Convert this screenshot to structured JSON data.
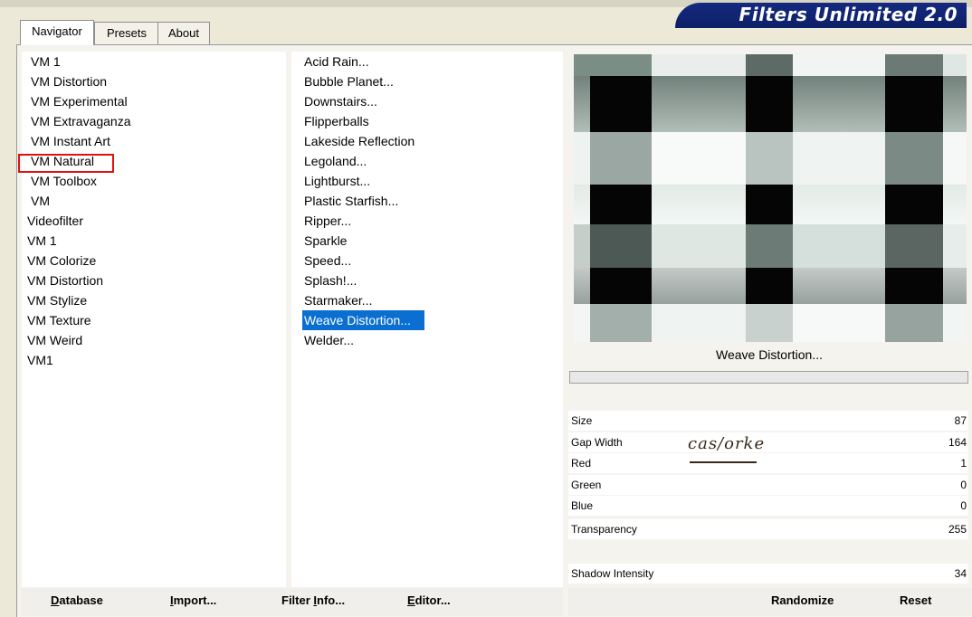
{
  "tabs": [
    "Navigator",
    "Presets",
    "About"
  ],
  "logo": "Filters Unlimited 2.0",
  "categories": [
    "VM 1",
    "VM Distortion",
    "VM Experimental",
    "VM Extravaganza",
    "VM Instant Art",
    "VM Natural",
    "VM Toolbox",
    "VM",
    "Videofilter",
    "VM 1",
    "VM Colorize",
    "VM Distortion",
    "VM Stylize",
    "VM Texture",
    "VM Weird",
    "VM1"
  ],
  "filters": [
    "Acid Rain...",
    "Bubble Planet...",
    "Downstairs...",
    "Flipperballs",
    "Lakeside Reflection",
    "Legoland...",
    "Lightburst...",
    "Plastic Starfish...",
    "Ripper...",
    "Sparkle",
    "Speed...",
    "Splash!...",
    "Starmaker...",
    "Weave Distortion...",
    "Welder..."
  ],
  "filter_name": "Weave Distortion...",
  "params": [
    {
      "label": "Size",
      "value": "87"
    },
    {
      "label": "Gap Width",
      "value": "164"
    },
    {
      "label": "Red",
      "value": "1"
    },
    {
      "label": "Green",
      "value": "0"
    },
    {
      "label": "Blue",
      "value": "0"
    },
    {
      "label": "Transparency",
      "value": "255"
    },
    {
      "label": "Shadow Intensity",
      "value": "34"
    }
  ],
  "watermark": "cas/orke",
  "buttons": {
    "database_first": "D",
    "database_rest": "atabase",
    "import_first": "I",
    "import_rest": "mport...",
    "filterinfo_pre": "Filter ",
    "filterinfo_u": "I",
    "filterinfo_rest": "nfo...",
    "editor_first": "E",
    "editor_rest": "ditor...",
    "randomize": "Randomize",
    "reset": "Reset"
  }
}
